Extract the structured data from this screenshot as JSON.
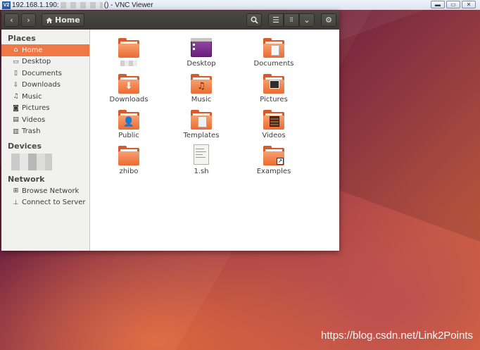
{
  "vnc": {
    "title_prefix": "192.168.1.190:",
    "title_suffix": "() - VNC Viewer",
    "logo": "V2",
    "controls": [
      "minimize",
      "restore",
      "close"
    ]
  },
  "toolbar": {
    "location": "Home"
  },
  "sidebar": {
    "places_header": "Places",
    "places": [
      {
        "label": "Home",
        "icon": "home-icon",
        "active": true
      },
      {
        "label": "Desktop",
        "icon": "desktop-icon"
      },
      {
        "label": "Documents",
        "icon": "documents-icon"
      },
      {
        "label": "Downloads",
        "icon": "downloads-icon"
      },
      {
        "label": "Music",
        "icon": "music-icon"
      },
      {
        "label": "Pictures",
        "icon": "pictures-icon"
      },
      {
        "label": "Videos",
        "icon": "videos-icon"
      },
      {
        "label": "Trash",
        "icon": "trash-icon"
      }
    ],
    "devices_header": "Devices",
    "network_header": "Network",
    "network": [
      {
        "label": "Browse Network",
        "icon": "network-icon"
      },
      {
        "label": "Connect to Server",
        "icon": "server-icon"
      }
    ]
  },
  "files": [
    {
      "label": "",
      "type": "folder"
    },
    {
      "label": "Desktop",
      "type": "desktop"
    },
    {
      "label": "Documents",
      "type": "folder-documents"
    },
    {
      "label": "Downloads",
      "type": "folder-downloads"
    },
    {
      "label": "Music",
      "type": "folder-music"
    },
    {
      "label": "Pictures",
      "type": "folder-pictures"
    },
    {
      "label": "Public",
      "type": "folder-public"
    },
    {
      "label": "Templates",
      "type": "folder-templates"
    },
    {
      "label": "Videos",
      "type": "folder-videos"
    },
    {
      "label": "zhibo",
      "type": "folder"
    },
    {
      "label": "1.sh",
      "type": "script"
    },
    {
      "label": "Examples",
      "type": "folder-link"
    }
  ],
  "watermark": "https://blog.csdn.net/Link2Points",
  "colors": {
    "accent": "#f07746",
    "folder": "#ec6a32",
    "header": "#3f3e39"
  }
}
